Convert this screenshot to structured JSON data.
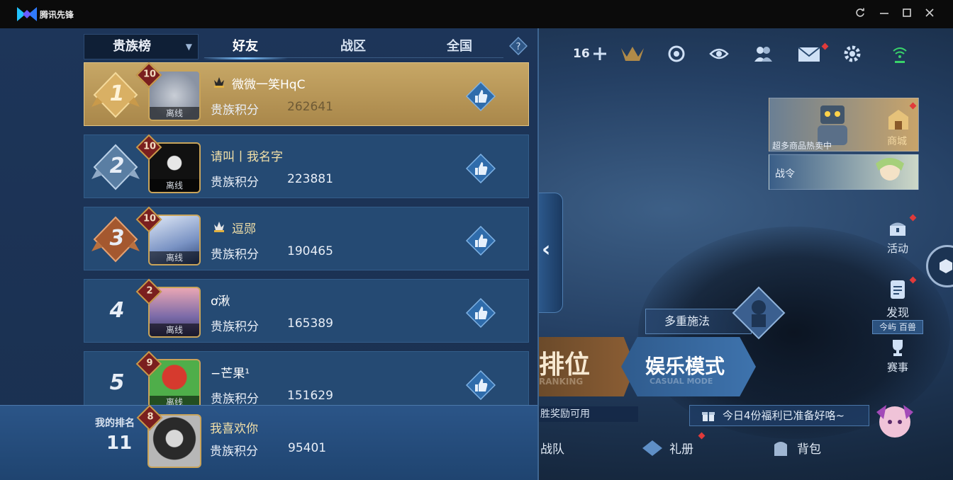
{
  "titlebar": {
    "app_name": "腾讯先锋",
    "buttons": [
      "refresh",
      "minimize",
      "maximize",
      "close"
    ]
  },
  "leaderboard": {
    "dropdown_label": "贵族榜",
    "tabs": [
      {
        "label": "好友",
        "active": true
      },
      {
        "label": "战区",
        "active": false
      },
      {
        "label": "全国",
        "active": false
      }
    ],
    "rows": [
      {
        "rank": "1",
        "level": "10",
        "status": "离线",
        "name": "微微一笑HqC",
        "svip": true,
        "score_label": "贵族积分",
        "score": "262641"
      },
      {
        "rank": "2",
        "level": "10",
        "status": "离线",
        "name": "请叫丨我名字",
        "svip": false,
        "score_label": "贵族积分",
        "score": "223881"
      },
      {
        "rank": "3",
        "level": "10",
        "status": "离线",
        "name": "逗郧",
        "svip": true,
        "score_label": "贵族积分",
        "score": "190465"
      },
      {
        "rank": "4",
        "level": "2",
        "status": "离线",
        "name": "ơ湫",
        "svip": false,
        "score_label": "贵族积分",
        "score": "165389"
      },
      {
        "rank": "5",
        "level": "9",
        "status": "离线",
        "name": "−芒果¹",
        "svip": false,
        "score_label": "贵族积分",
        "score": "151629"
      }
    ],
    "my_rank": {
      "label": "我的排名",
      "rank": "11",
      "level": "8",
      "name": "我喜欢你",
      "score_label": "贵族积分",
      "score": "95401"
    }
  },
  "game": {
    "top_count": "16",
    "shop_caption": "超多商品热卖中",
    "shop_label": "商城",
    "battle_pass_label": "战令",
    "right_menu": [
      {
        "label": "活动"
      },
      {
        "label": "发现"
      },
      {
        "label": "赛事"
      }
    ],
    "discover_tag": "今屿 百兽",
    "multi_cast_label": "多重施法",
    "ranked_label": "排位",
    "ranked_sub": "RANKING",
    "casual_label": "娱乐模式",
    "casual_sub": "CASUAL MODE",
    "ticker": "胜奖励可用",
    "notice": "今日4份福利已准备好咯~",
    "bottom_nav": [
      {
        "label": "战队"
      },
      {
        "label": "礼册"
      },
      {
        "label": "背包"
      }
    ]
  },
  "colors": {
    "panel_bg": "#1d3559",
    "row_bg": "#254a73",
    "first_row_gold": "#c7a766",
    "accent_blue": "#7ec3ff",
    "level_badge": "#7a1f1f"
  }
}
